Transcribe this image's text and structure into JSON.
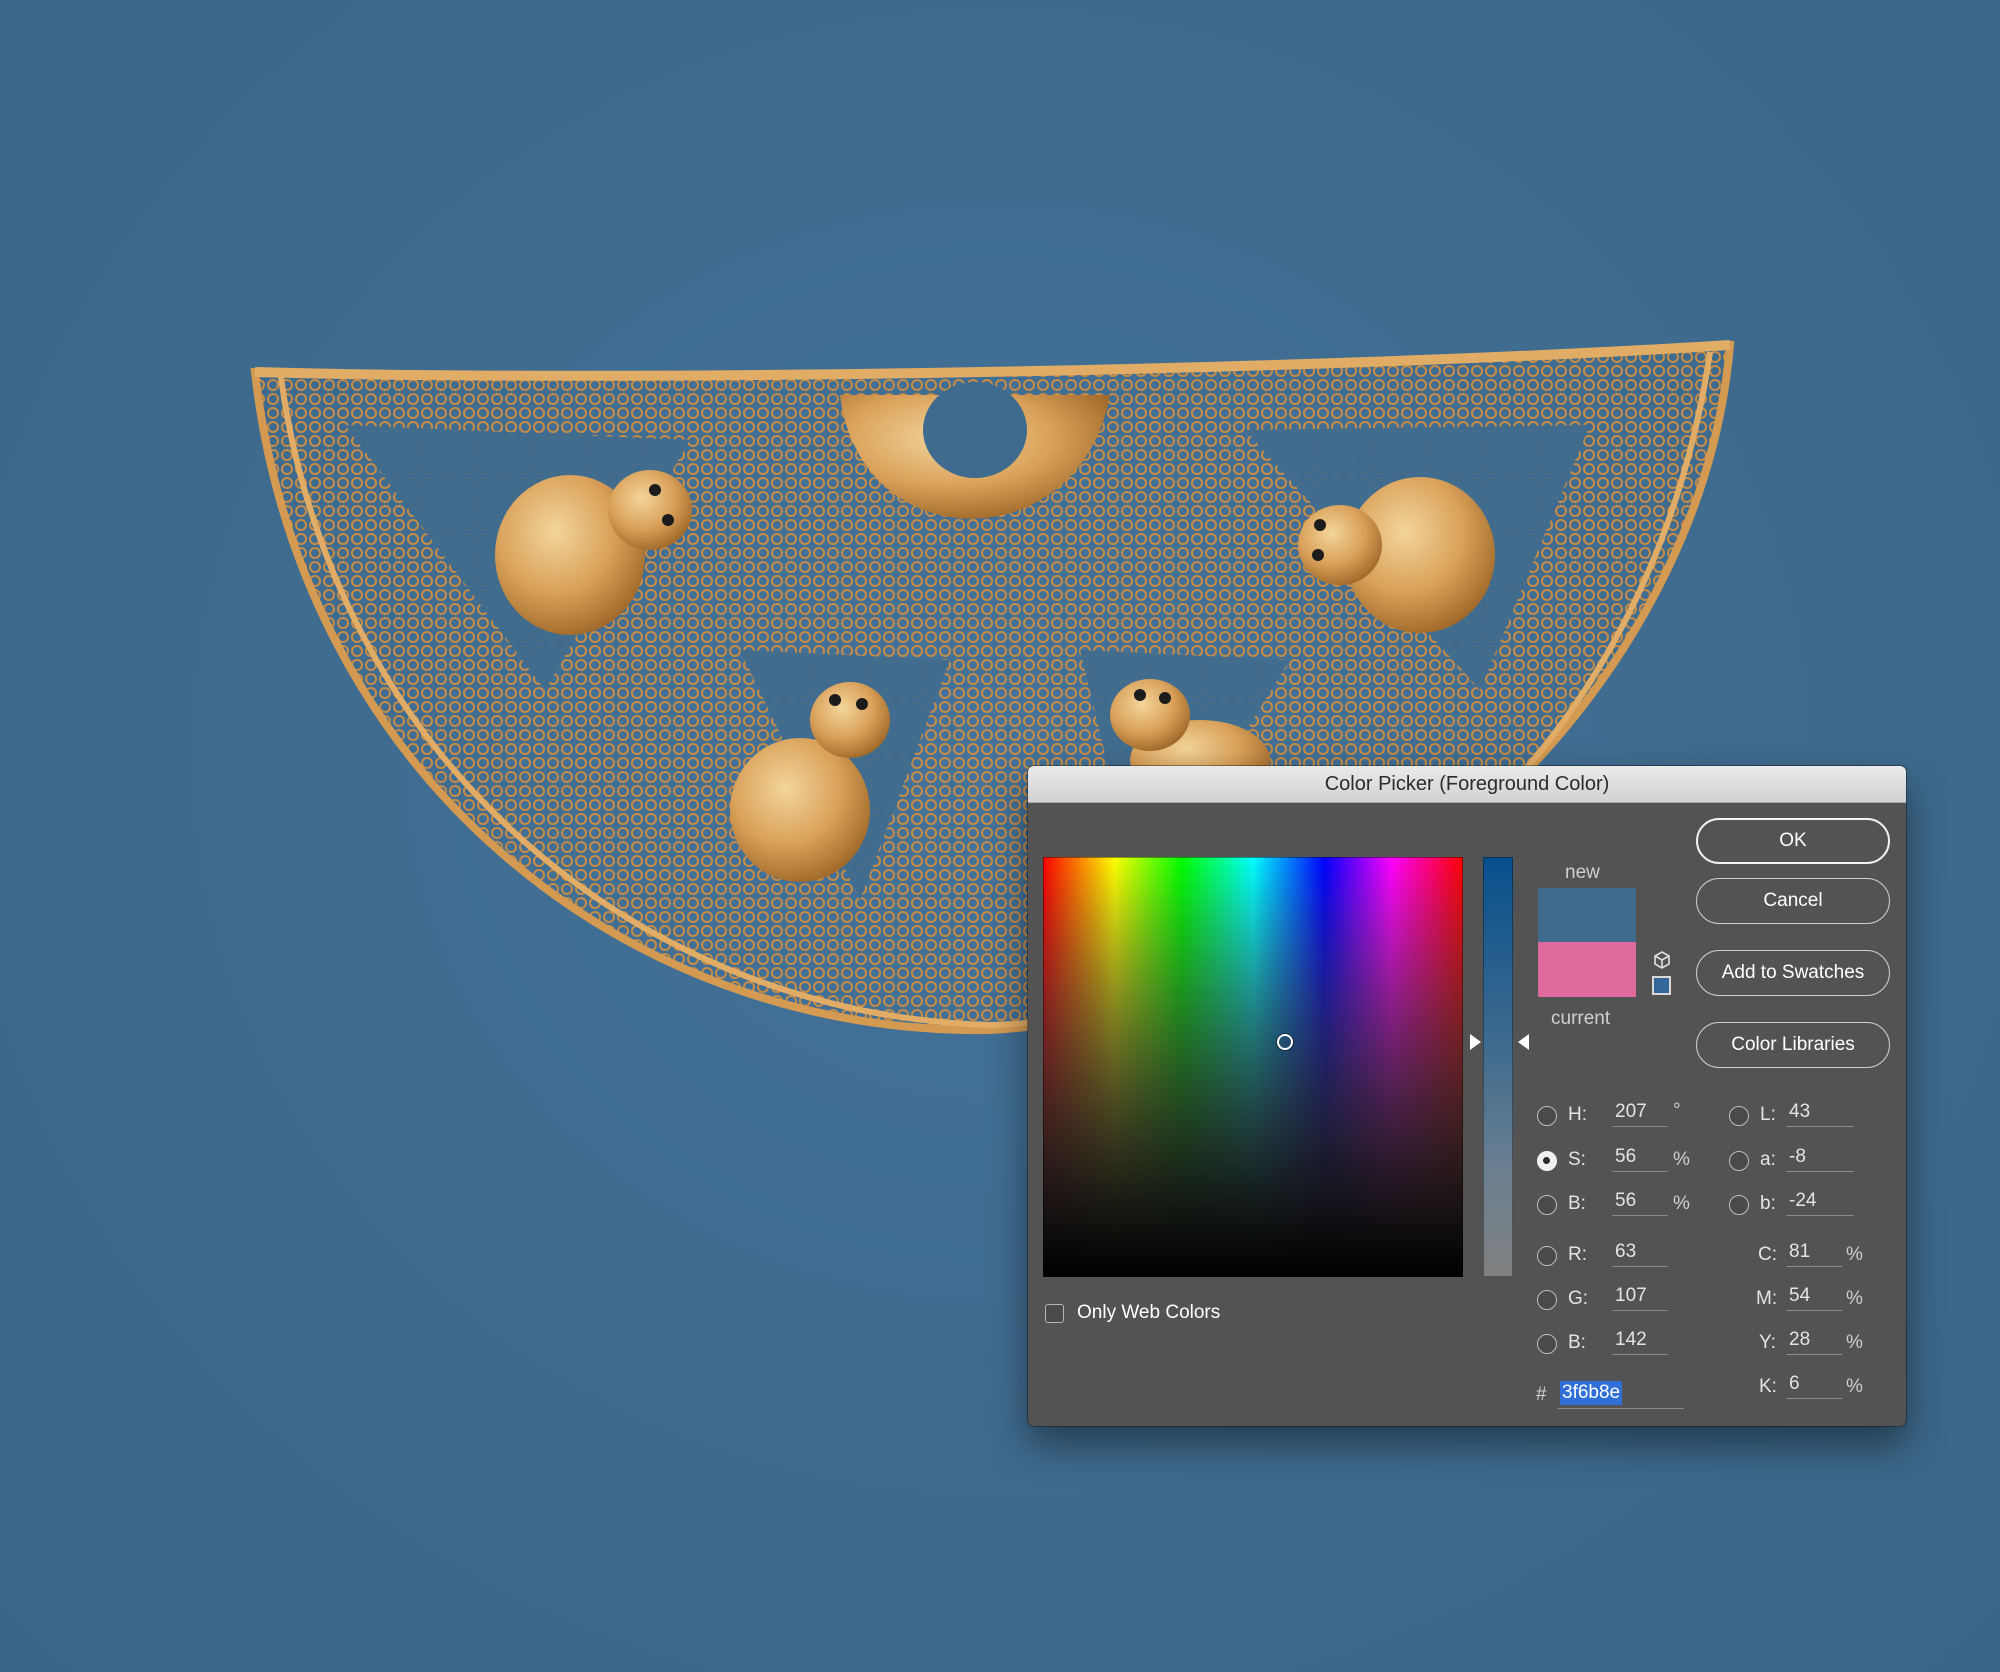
{
  "dialog": {
    "title": "Color Picker (Foreground Color)",
    "buttons": {
      "ok": "OK",
      "cancel": "Cancel",
      "add_to_swatches": "Add to Swatches",
      "color_libraries": "Color Libraries"
    },
    "preview": {
      "new_label": "new",
      "current_label": "current",
      "new_color": "#3f6b8e",
      "current_color": "#df6a9b"
    },
    "field": {
      "mode": "saturation",
      "hue_deg": 207,
      "marker_brightness_pct": 56,
      "marker_hue_deg": 207,
      "slider_saturation_pct": 56
    },
    "hsb": {
      "h_label": "H:",
      "h_value": "207",
      "h_unit": "°",
      "s_label": "S:",
      "s_value": "56",
      "s_unit": "%",
      "b_label": "B:",
      "b_value": "56",
      "b_unit": "%",
      "selected": "S"
    },
    "rgb": {
      "r_label": "R:",
      "r_value": "63",
      "g_label": "G:",
      "g_value": "107",
      "b_label": "B:",
      "b_value": "142"
    },
    "lab": {
      "l_label": "L:",
      "l_value": "43",
      "a_label": "a:",
      "a_value": "-8",
      "b_label": "b:",
      "b_value": "-24"
    },
    "cmyk": {
      "c_label": "C:",
      "c_value": "81",
      "c_unit": "%",
      "m_label": "M:",
      "m_value": "54",
      "m_unit": "%",
      "y_label": "Y:",
      "y_value": "28",
      "y_unit": "%",
      "k_label": "K:",
      "k_value": "6",
      "k_unit": "%"
    },
    "hex": {
      "prefix": "#",
      "value": "3f6b8e"
    },
    "only_web_colors": {
      "label": "Only Web Colors",
      "checked": false
    },
    "websafe_color": "#336699"
  },
  "background": {
    "color": "#3f6b8e",
    "artwork_metal_color": "#d9a15a"
  }
}
